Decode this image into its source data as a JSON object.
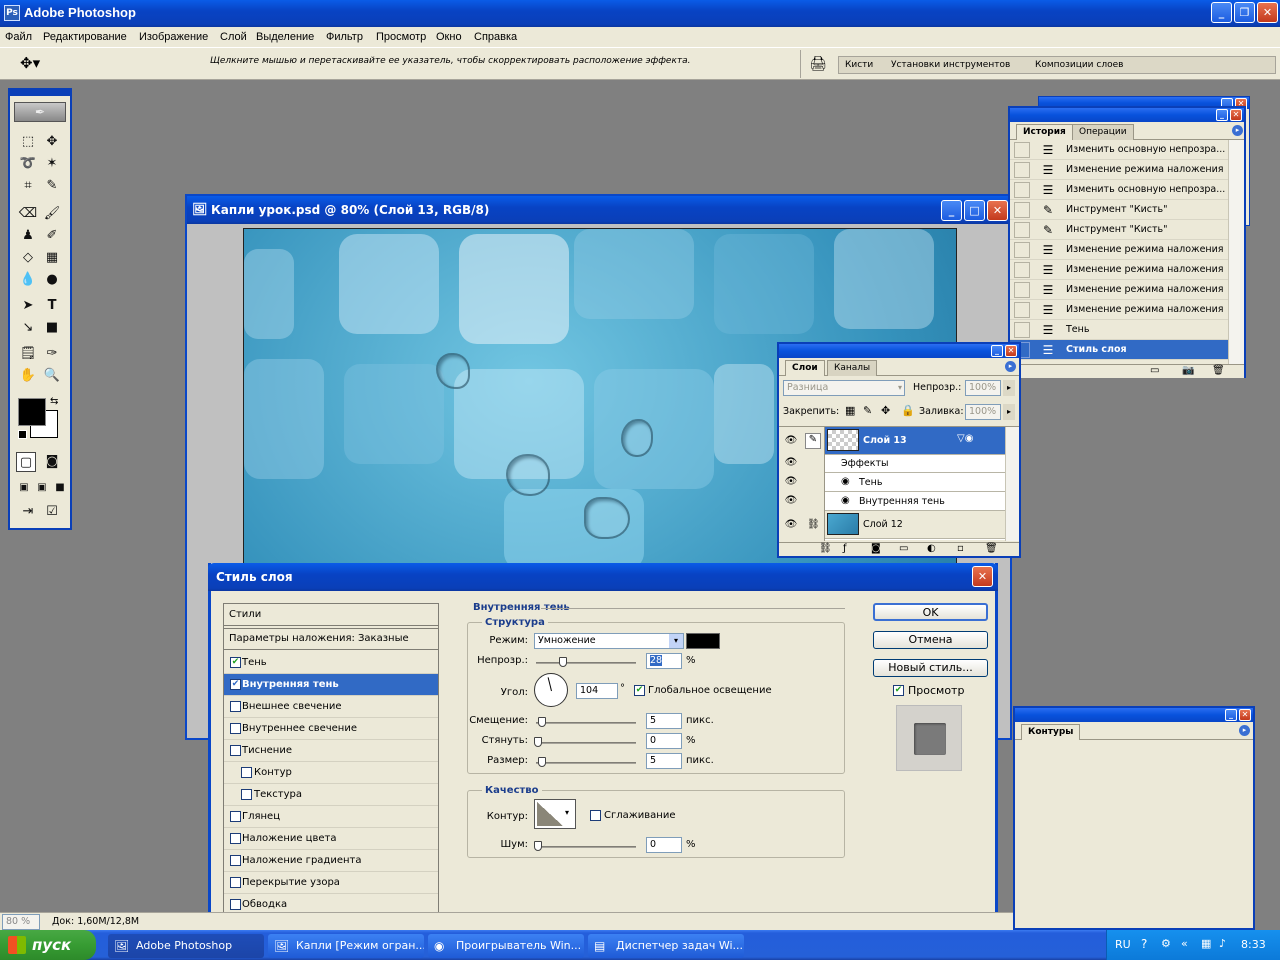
{
  "app": {
    "title": "Adobe Photoshop"
  },
  "menu": [
    "Файл",
    "Редактирование",
    "Изображение",
    "Слой",
    "Выделение",
    "Фильтр",
    "Просмотр",
    "Окно",
    "Справка"
  ],
  "options_bar": {
    "hint": "Щелкните мышью и перетаскивайте ее указатель, чтобы скорректировать расположение эффекта.",
    "well_tabs": [
      "Кисти",
      "Установки инструментов",
      "Композиции слоев"
    ]
  },
  "document": {
    "title": "Капли урок.psd @ 80% (Слой 13, RGB/8)",
    "zoom": "80 %",
    "doc_info": "Док: 1,60М/12,8М"
  },
  "history": {
    "tabs": [
      "История",
      "Операции"
    ],
    "items": [
      {
        "label": "Изменить основную непрозра...",
        "icon": "history-state-icon"
      },
      {
        "label": "Изменение режима наложения",
        "icon": "history-state-icon"
      },
      {
        "label": "Изменить основную непрозра...",
        "icon": "history-state-icon"
      },
      {
        "label": "Инструмент \"Кисть\"",
        "icon": "brush-icon"
      },
      {
        "label": "Инструмент \"Кисть\"",
        "icon": "brush-icon"
      },
      {
        "label": "Изменение режима наложения",
        "icon": "history-state-icon"
      },
      {
        "label": "Изменение режима наложения",
        "icon": "history-state-icon"
      },
      {
        "label": "Изменение режима наложения",
        "icon": "history-state-icon"
      },
      {
        "label": "Изменение режима наложения",
        "icon": "history-state-icon"
      },
      {
        "label": "Тень",
        "icon": "history-state-icon"
      },
      {
        "label": "Стиль слоя",
        "icon": "history-state-icon",
        "selected": true
      }
    ]
  },
  "layers": {
    "tabs": [
      "Слои",
      "Каналы"
    ],
    "blend_mode": "Разница",
    "opacity_label": "Непрозр.:",
    "opacity": "100%",
    "lock_label": "Закрепить:",
    "fill_label": "Заливка:",
    "fill": "100%",
    "items": [
      {
        "name": "Слой 13",
        "selected": true
      },
      {
        "name": "Эффекты"
      },
      {
        "name": "Тень"
      },
      {
        "name": "Внутренняя тень"
      },
      {
        "name": "Слой 12"
      }
    ]
  },
  "contours_panel": {
    "tab": "Контуры"
  },
  "layer_style": {
    "title": "Стиль слоя",
    "list": {
      "header": "Стили",
      "blend": "Параметры наложения: Заказные",
      "items": [
        {
          "label": "Тень",
          "checked": true
        },
        {
          "label": "Внутренняя тень",
          "checked": true,
          "selected": true
        },
        {
          "label": "Внешнее свечение",
          "checked": false
        },
        {
          "label": "Внутреннее свечение",
          "checked": false
        },
        {
          "label": "Тиснение",
          "checked": false
        },
        {
          "label": "Контур",
          "checked": false,
          "indent": true
        },
        {
          "label": "Текстура",
          "checked": false,
          "indent": true
        },
        {
          "label": "Глянец",
          "checked": false
        },
        {
          "label": "Наложение цвета",
          "checked": false
        },
        {
          "label": "Наложение градиента",
          "checked": false
        },
        {
          "label": "Перекрытие узора",
          "checked": false
        },
        {
          "label": "Обводка",
          "checked": false
        }
      ]
    },
    "section_title": "Внутренняя тень",
    "structure": {
      "title": "Структура",
      "mode_label": "Режим:",
      "mode": "Умножение",
      "color": "#000000",
      "opacity_label": "Непрозр.:",
      "opacity": "28",
      "opacity_unit": "%",
      "opacity_fraction": 0.28,
      "angle_label": "Угол:",
      "angle": "104",
      "angle_unit": "°",
      "global_light_label": "Глобальное освещение",
      "global_light": true,
      "distance_label": "Смещение:",
      "distance": "5",
      "distance_unit": "пикс.",
      "choke_label": "Стянуть:",
      "choke": "0",
      "choke_unit": "%",
      "size_label": "Размер:",
      "size": "5",
      "size_unit": "пикс."
    },
    "quality": {
      "title": "Качество",
      "contour_label": "Контур:",
      "antialias_label": "Сглаживание",
      "noise_label": "Шум:",
      "noise": "0",
      "noise_unit": "%"
    },
    "buttons": {
      "ok": "OK",
      "cancel": "Отмена",
      "new_style": "Новый стиль...",
      "preview": "Просмотр"
    }
  },
  "taskbar": {
    "start": "пуск",
    "tasks": [
      "Adobe Photoshop",
      "Капли [Режим огран...",
      "Проигрыватель Win...",
      "Диспетчер задач Wi..."
    ],
    "lang": "RU",
    "time": "8:33"
  }
}
